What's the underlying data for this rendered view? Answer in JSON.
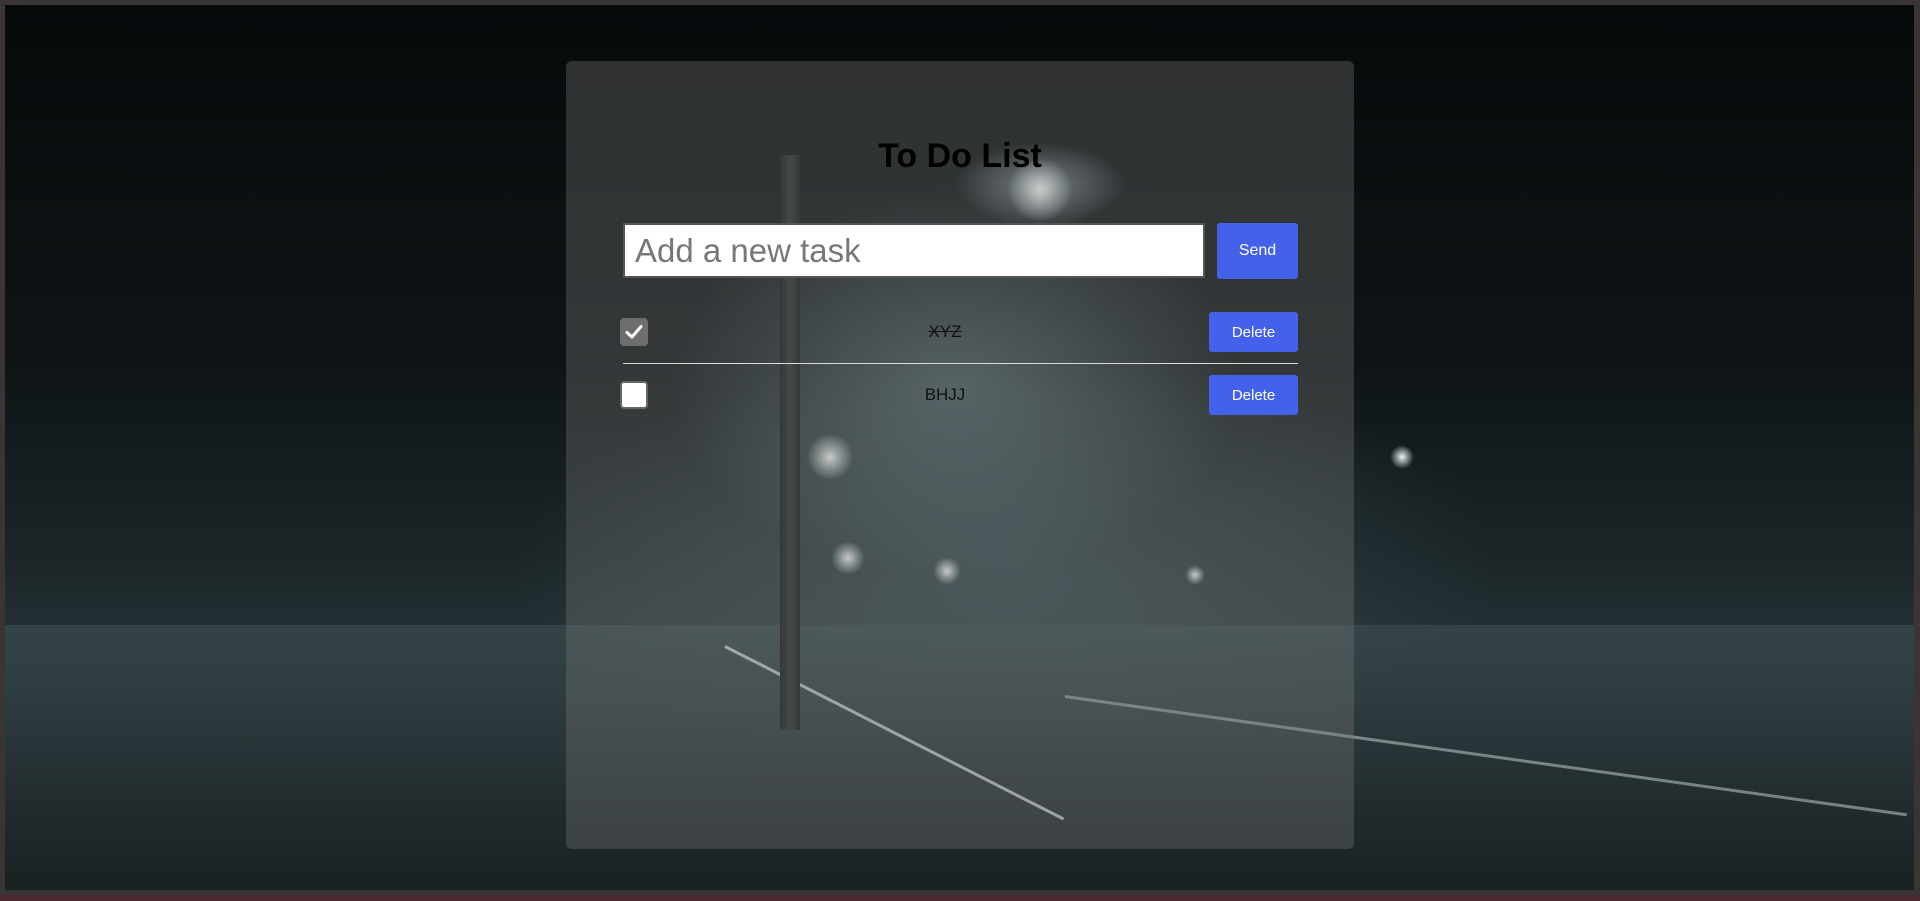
{
  "app": {
    "title": "To Do List"
  },
  "new_task": {
    "placeholder": "Add a new task",
    "value": "",
    "send_label": "Send"
  },
  "tasks": [
    {
      "text": "XYZ",
      "completed": true,
      "delete_label": "Delete"
    },
    {
      "text": "BHJJ",
      "completed": false,
      "delete_label": "Delete"
    }
  ],
  "colors": {
    "accent": "#4461ec",
    "card_overlay": "rgba(120,120,120,0.35)",
    "title_text": "#000000"
  },
  "icons": {
    "checkmark": "check-icon"
  }
}
